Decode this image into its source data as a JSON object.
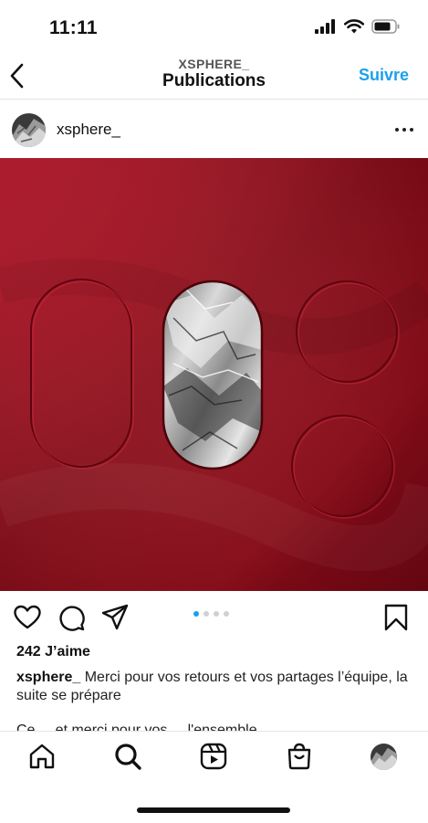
{
  "status_bar": {
    "time": "11:11",
    "icons": [
      "signal-icon",
      "wifi-icon",
      "battery-icon"
    ]
  },
  "header": {
    "subtitle": "XSPHERE_",
    "title": "Publications",
    "follow_label": "Suivre",
    "back_icon": "chevron-left-icon"
  },
  "post": {
    "username": "xsphere_",
    "image_description_colors": {
      "primary": "#a0101c",
      "accent": "#c8c8c8"
    },
    "carousel": {
      "count": 4,
      "active_index": 0
    },
    "likes": "242 J’aime",
    "caption_user": "xsphere_",
    "caption_text": " Merci pour vos retours et vos partages l’équipe, la suite se prépare",
    "caption_more": "Ce ... et merci pour vos ... l'ensemble ..."
  },
  "actions": [
    "heart-icon",
    "comment-icon",
    "share-icon",
    "bookmark-icon"
  ],
  "tab_bar": [
    "home-icon",
    "search-icon",
    "reels-icon",
    "shop-icon",
    "profile-avatar"
  ],
  "colors": {
    "accent": "#1aa0ec",
    "text": "#111111"
  }
}
